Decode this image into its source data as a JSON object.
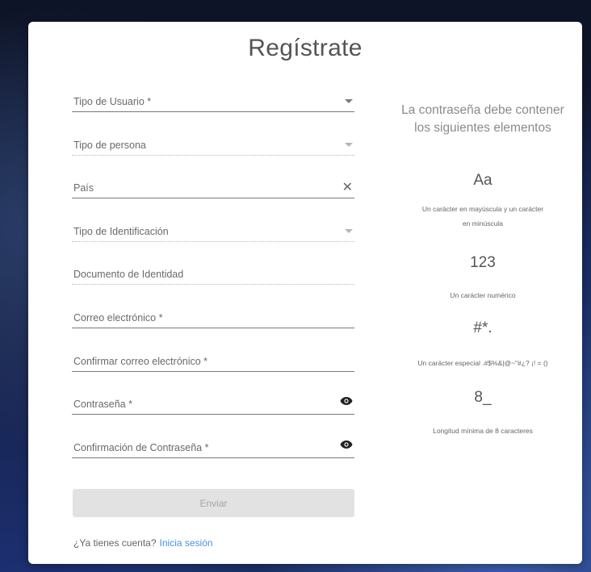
{
  "form": {
    "title": "Regístrate",
    "fields": [
      {
        "label": "Tipo de Usuario *",
        "icon": "chevron-down-icon"
      },
      {
        "label": "Tipo de persona",
        "icon": "chevron-down-icon"
      },
      {
        "label": "País",
        "icon": "close-icon",
        "icon_glyph": "✕"
      },
      {
        "label": "Tipo de Identificación",
        "icon": "chevron-down-icon"
      },
      {
        "label": "Documento de Identidad"
      },
      {
        "label": "Correo electrónico *"
      },
      {
        "label": "Confirmar correo electrónico *"
      },
      {
        "label": "Contraseña *",
        "icon": "eye-icon"
      },
      {
        "label": "Confirmación de Contraseña *",
        "icon": "eye-icon"
      }
    ],
    "submit_label": "Enviar",
    "login_prompt": "¿Ya tienes cuenta?",
    "login_link": "Inicia sesión"
  },
  "password_rules": {
    "heading_line1": "La contraseña debe contener",
    "heading_line2": "los siguientes elementos",
    "items": [
      {
        "symbol": "Aa",
        "desc_line1": "Un carácter en mayúscula y un carácter",
        "desc_line2": "en minúscula"
      },
      {
        "symbol": "123",
        "desc_line1": "Un carácter numérico"
      },
      {
        "symbol": "#*.",
        "desc_line1": "Un carácter especial .#$%&|@~\"#¿? ¡! = ()"
      },
      {
        "symbol": "8_",
        "desc_line1": "Longitud mínima de 8 caracteres"
      }
    ]
  },
  "colors": {
    "link": "#4a90e2",
    "button_bg": "#e2e2e2",
    "button_text": "#a5a5a5"
  }
}
